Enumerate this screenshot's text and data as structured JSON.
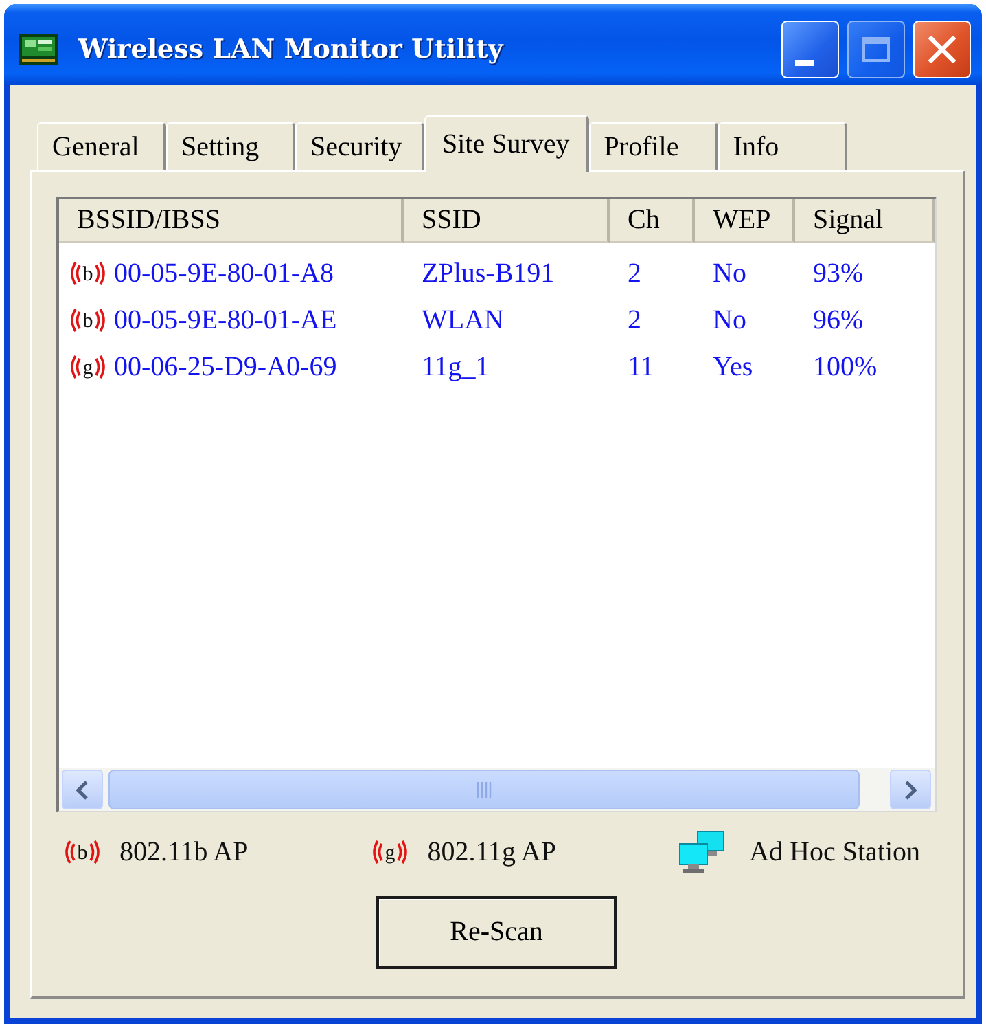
{
  "window": {
    "title": "Wireless LAN Monitor Utility",
    "maximize_disabled": true
  },
  "tabs": [
    {
      "label": "General",
      "selected": false
    },
    {
      "label": "Setting",
      "selected": false
    },
    {
      "label": "Security",
      "selected": false
    },
    {
      "label": "Site Survey",
      "selected": true
    },
    {
      "label": "Profile",
      "selected": false
    },
    {
      "label": "Info",
      "selected": false
    }
  ],
  "table": {
    "columns": [
      "BSSID/IBSS",
      "SSID",
      "Ch",
      "WEP",
      "Signal"
    ],
    "rows": [
      {
        "band": "b",
        "bssid": "00-05-9E-80-01-A8",
        "ssid": "ZPlus-B191",
        "ch": "2",
        "wep": "No",
        "signal": "93%",
        "selected": false
      },
      {
        "band": "b",
        "bssid": "00-05-9E-80-01-AE",
        "ssid": "WLAN",
        "ch": "2",
        "wep": "No",
        "signal": "96%",
        "selected": false
      },
      {
        "band": "g",
        "bssid": "00-06-25-D9-A0-69",
        "ssid": "11g_1",
        "ch": "11",
        "wep": "Yes",
        "signal": "100%",
        "selected": false
      }
    ]
  },
  "legend": [
    {
      "kind": "ap",
      "band": "b",
      "label": "802.11b AP"
    },
    {
      "kind": "ap",
      "band": "g",
      "label": "802.11g AP"
    },
    {
      "kind": "adhoc",
      "label": "Ad Hoc Station"
    }
  ],
  "button": {
    "label": "Re-Scan"
  }
}
